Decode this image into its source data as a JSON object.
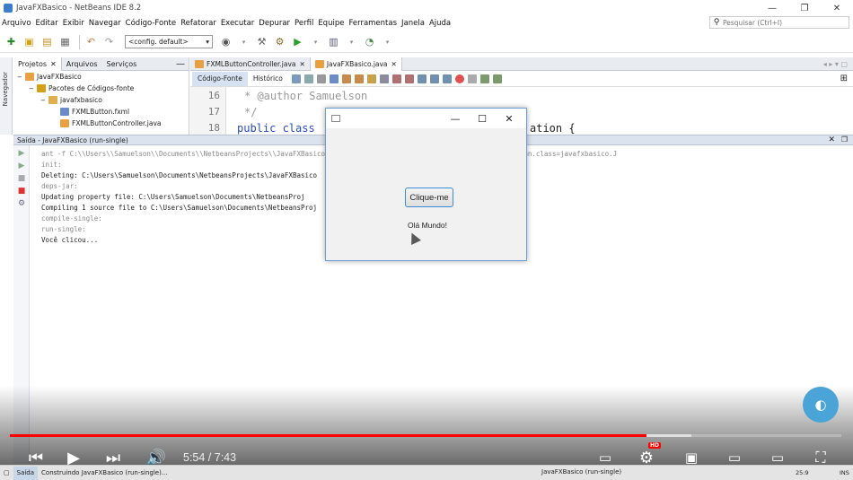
{
  "window": {
    "title": "JavaFXBasico - NetBeans IDE 8.2",
    "controls": [
      "—",
      "❐",
      "✕"
    ]
  },
  "menu": [
    "Arquivo",
    "Editar",
    "Exibir",
    "Navegar",
    "Código-Fonte",
    "Refatorar",
    "Executar",
    "Depurar",
    "Perfil",
    "Equipe",
    "Ferramentas",
    "Janela",
    "Ajuda"
  ],
  "search": {
    "placeholder": "Pesquisar (Ctrl+I)"
  },
  "toolbar": {
    "config": "<config. default>"
  },
  "navigator_label": "Navegador",
  "project_tabs": [
    "Projetos",
    "Arquivos",
    "Serviços"
  ],
  "tree": [
    {
      "label": "JavaFXBasico",
      "indent": 0,
      "toggle": "−"
    },
    {
      "label": "Pacotes de Códigos-fonte",
      "indent": 1,
      "toggle": "−"
    },
    {
      "label": "javafxbasico",
      "indent": 2,
      "toggle": "−"
    },
    {
      "label": "FXMLButton.fxml",
      "indent": 3,
      "toggle": ""
    },
    {
      "label": "FXMLButtonController.java",
      "indent": 3,
      "toggle": ""
    }
  ],
  "editor_tabs": [
    "FXMLButtonController.java",
    "JavaFXBasico.java"
  ],
  "editor_views": [
    "Código-Fonte",
    "Histórico"
  ],
  "code": {
    "lines": [
      {
        "num": "16",
        "text": "* @author Samuelson"
      },
      {
        "num": "17",
        "text": "*/"
      },
      {
        "num": "18",
        "text": "public class"
      }
    ],
    "suffix": "ation {"
  },
  "output": {
    "title": "Saída - JavaFXBasico (run-single)",
    "lines": [
      {
        "text": "ant -f C:\\\\Users\\\\Samuelson\\\\Documents\\\\NetbeansProjects\\\\JavaFXBasico                                                   co.java -Dnb.internal.action.name=run.single -Drun.class=javafxbasico.J",
        "style": "grey"
      },
      {
        "text": "init:",
        "style": "grey"
      },
      {
        "text": "Deleting: C:\\Users\\Samuelson\\Documents\\NetbeansProjects\\JavaFXBasico",
        "style": "norm"
      },
      {
        "text": "deps-jar:",
        "style": "grey"
      },
      {
        "text": "Updating property file: C:\\Users\\Samuelson\\Documents\\NetbeansProj",
        "style": "norm"
      },
      {
        "text": "Compiling 1 source file to C:\\Users\\Samuelson\\Documents\\NetbeansProj",
        "style": "norm"
      },
      {
        "text": "compile-single:",
        "style": "grey"
      },
      {
        "text": "run-single:",
        "style": "grey"
      },
      {
        "text": "Você clicou...",
        "style": "norm"
      }
    ]
  },
  "fx_window": {
    "controls": [
      "—",
      "☐",
      "✕"
    ],
    "button_label": "Clique-me",
    "label": "Olá Mundo!"
  },
  "video": {
    "time": "5:54 / 7:43",
    "progress": 0.766,
    "loaded": 0.82,
    "hd": "HD"
  },
  "status": {
    "tab": "Saída",
    "progress": "Construindo JavaFXBasico (run-single)...",
    "right": "JavaFXBasico (run-single)",
    "position": "25:9",
    "mode": "INS"
  },
  "colors": {
    "accent": "#3a8ad6",
    "progress_red": "#ff0000",
    "panel_header": "#dbe3ee"
  }
}
